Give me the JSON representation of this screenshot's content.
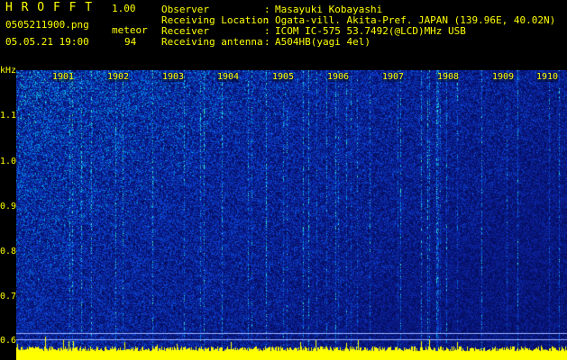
{
  "header": {
    "app_title": "H R O F F T",
    "version": "1.00",
    "filename": "0505211900.png",
    "datetime": "05.05.21 19:00",
    "meteor_label": "meteor",
    "meteor_count": "94",
    "info_rows": [
      {
        "label": "Observer",
        "sep": ":",
        "value": "Masayuki Kobayashi"
      },
      {
        "label": "Receiving Location",
        "sep": ":",
        "value": "Ogata-vill. Akita-Pref. JAPAN (139.96E, 40.02N)"
      },
      {
        "label": "Receiver",
        "sep": ":",
        "value": "ICOM IC-575 53.7492(@LCD)MHz USB"
      },
      {
        "label": "Receiving antenna",
        "sep": ":",
        "value": "A504HB(yagi 4el)"
      }
    ]
  },
  "axis": {
    "y_unit": "kHz",
    "y_ticks": [
      "1.1",
      "1.0",
      "0.9",
      "0.8",
      "0.7",
      "0.6"
    ],
    "x_ticks": [
      "1901",
      "1902",
      "1903",
      "1904",
      "1905",
      "1906",
      "1907",
      "1908",
      "1909",
      "1910"
    ]
  },
  "colors": {
    "background": "#000000",
    "text": "#ffff00",
    "spectrum_base": "#0a1a8a",
    "signal_cyan": "#00ffff",
    "level_yellow": "#ffff00"
  }
}
